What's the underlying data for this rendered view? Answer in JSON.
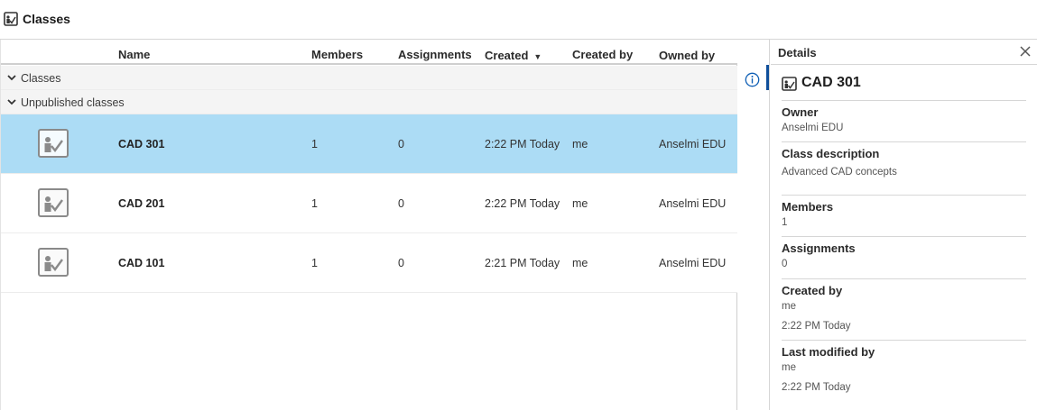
{
  "header": {
    "title": "Classes",
    "icon": "class-icon"
  },
  "table": {
    "columns": {
      "name": "Name",
      "members": "Members",
      "assignments": "Assignments",
      "created": "Created",
      "created_by": "Created by",
      "owned_by": "Owned by"
    },
    "sort": {
      "column": "Created",
      "direction": "descending"
    },
    "groups": [
      "Classes",
      "Unpublished classes"
    ],
    "rows": [
      {
        "name": "CAD 301",
        "members": "1",
        "assignments": "0",
        "created": "2:22 PM Today",
        "created_by": "me",
        "owned_by": "Anselmi EDU",
        "selected": true
      },
      {
        "name": "CAD 201",
        "members": "1",
        "assignments": "0",
        "created": "2:22 PM Today",
        "created_by": "me",
        "owned_by": "Anselmi EDU",
        "selected": false
      },
      {
        "name": "CAD 101",
        "members": "1",
        "assignments": "0",
        "created": "2:21 PM Today",
        "created_by": "me",
        "owned_by": "Anselmi EDU",
        "selected": false
      }
    ]
  },
  "details": {
    "title": "Details",
    "name": "CAD 301",
    "owner_label": "Owner",
    "owner": "Anselmi EDU",
    "description_label": "Class description",
    "description": "Advanced CAD concepts",
    "members_label": "Members",
    "members": "1",
    "assignments_label": "Assignments",
    "assignments": "0",
    "created_by_label": "Created by",
    "created_by": "me",
    "created_time": "2:22 PM Today",
    "modified_by_label": "Last modified by",
    "modified_by": "me",
    "modified_time": "2:22 PM Today"
  },
  "colors": {
    "selected_row": "#acdcf5",
    "accent": "#0f4f9b"
  }
}
